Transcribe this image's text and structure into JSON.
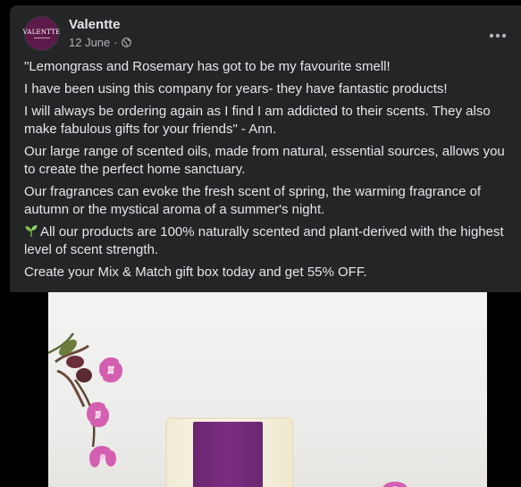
{
  "post": {
    "page_name": "Valentte",
    "avatar_text": "VALENTTE",
    "date": "12 June",
    "separator": "·",
    "privacy_icon": "globe-icon",
    "more_icon": "more-options-icon",
    "paragraphs": [
      "\"Lemongrass and Rosemary has got to be my favourite smell!",
      "I have been using this company for years- they have fantastic products!",
      " I will always be ordering again as I find I am addicted to their scents. They also make fabulous gifts for your friends\" - Ann.",
      "Our large range of scented oils, made from natural, essential sources, allows you to create the perfect home sanctuary.",
      "Our fragrances can evoke the fresh scent of spring, the warming fragrance of autumn or the mystical aroma of a summer's night.",
      "All our products are 100% naturally scented and plant-derived with the highest level of scent strength.",
      "Create your Mix & Match gift box today and get 55% OFF."
    ],
    "sprout_icon": "seedling-icon"
  },
  "colors": {
    "background": "#000000",
    "card": "#242526",
    "primary_text": "#e4e6eb",
    "secondary_text": "#b0b3b8",
    "brand": "#5b1a49",
    "candle_label": "#7b2d82",
    "flower": "#d45fb0"
  }
}
